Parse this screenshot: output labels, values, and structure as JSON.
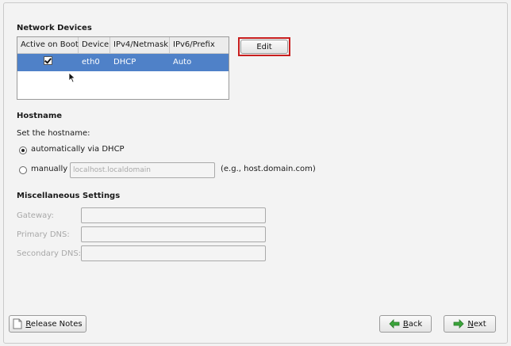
{
  "network_devices": {
    "title": "Network Devices",
    "columns": [
      "Active on Boot",
      "Device",
      "IPv4/Netmask",
      "IPv6/Prefix"
    ],
    "rows": [
      {
        "active": true,
        "device": "eth0",
        "ipv4": "DHCP",
        "ipv6": "Auto"
      }
    ],
    "edit_label": "Edit"
  },
  "hostname": {
    "title": "Hostname",
    "set_label": "Set the hostname:",
    "auto_label": "automatically via DHCP",
    "manual_label": "manually",
    "manual_placeholder": "localhost.localdomain",
    "example": "(e.g., host.domain.com)",
    "selected": "automatic"
  },
  "misc": {
    "title": "Miscellaneous Settings",
    "gateway_label": "Gateway:",
    "primary_dns_label": "Primary DNS:",
    "secondary_dns_label": "Secondary DNS:"
  },
  "footer": {
    "release_notes_label": "Release Notes",
    "back_label": "Back",
    "next_label": "Next"
  },
  "icons": {
    "release_notes": "document-icon",
    "back": "arrow-left-icon",
    "next": "arrow-right-icon",
    "cursor": "mouse-pointer-icon"
  },
  "colors": {
    "selection": "#4f81c8",
    "highlight": "#c81e1e",
    "arrow_green": "#3aa43a"
  }
}
